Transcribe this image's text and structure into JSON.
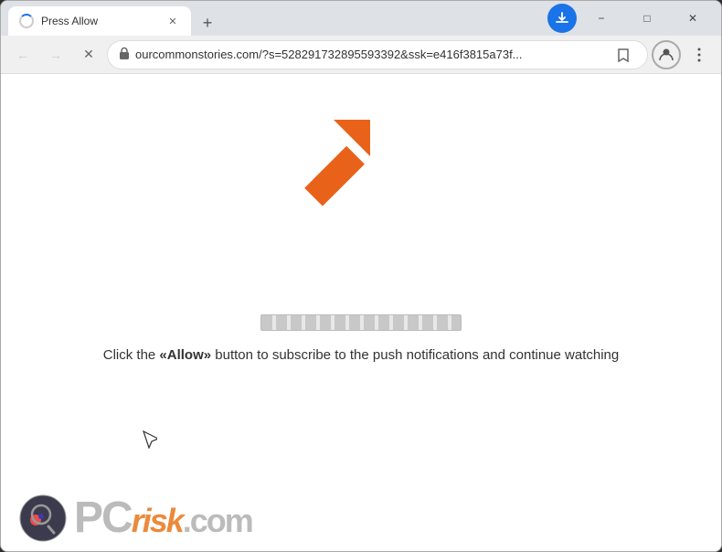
{
  "window": {
    "title": "Press Allow",
    "controls": {
      "minimize": "−",
      "maximize": "□",
      "close": "✕"
    }
  },
  "titlebar": {
    "tab": {
      "title": "Press Allow",
      "close_label": "✕"
    },
    "new_tab_label": "+"
  },
  "toolbar": {
    "back_label": "←",
    "forward_label": "→",
    "stop_label": "✕",
    "url": "ourcommonstories.com/?s=528291732895593392&ssk=e416f3815a73f...",
    "bookmark_label": "☆",
    "profile_label": "👤",
    "menu_label": "⋮"
  },
  "page": {
    "subscribe_text_before": "Click the ",
    "subscribe_allow": "«Allow»",
    "subscribe_text_after": " button to subscribe to the push notifications and continue watching",
    "subscribe_full": "Click the «Allow» button to subscribe to the push notifications and continue watching"
  },
  "watermark": {
    "pc_text": "PC",
    "risk_text": "risk.com"
  },
  "icons": {
    "lock": "🔒",
    "spinner": "spinner",
    "arrow": "↖",
    "cursor": "↖"
  }
}
